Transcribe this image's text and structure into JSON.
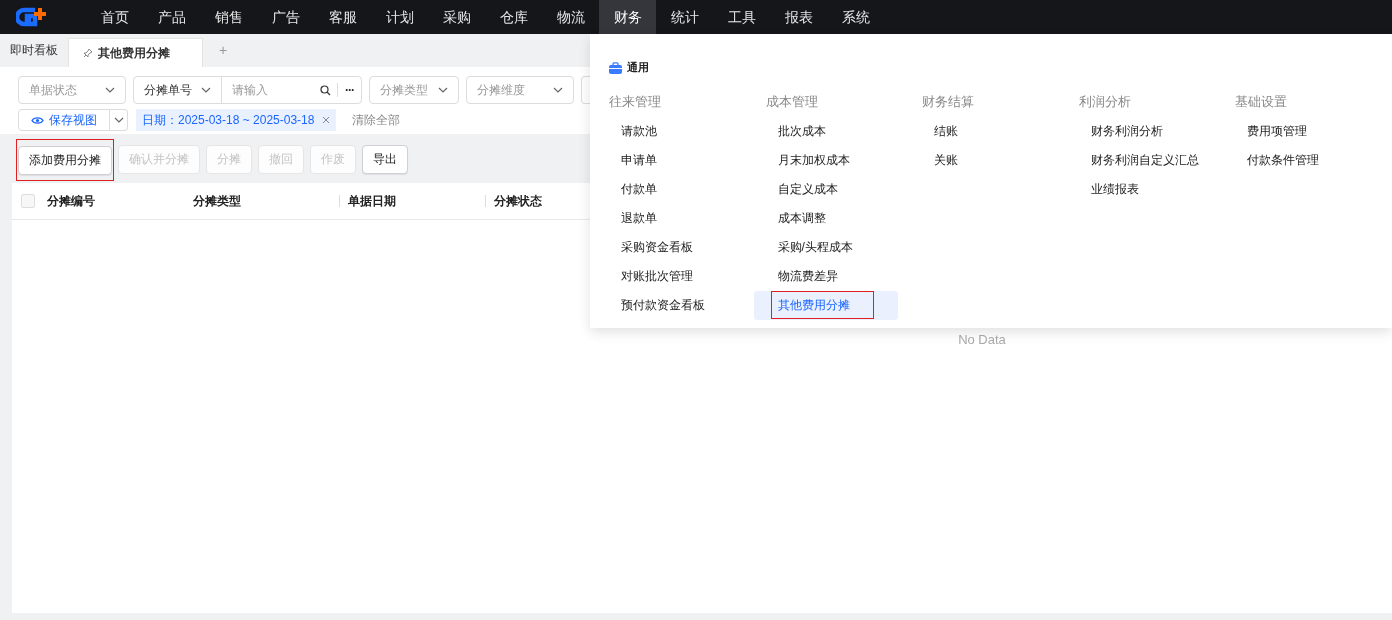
{
  "nav": {
    "items": [
      {
        "label": "首页",
        "selected": false
      },
      {
        "label": "产品",
        "selected": false
      },
      {
        "label": "销售",
        "selected": false
      },
      {
        "label": "广告",
        "selected": false
      },
      {
        "label": "客服",
        "selected": false
      },
      {
        "label": "计划",
        "selected": false
      },
      {
        "label": "采购",
        "selected": false
      },
      {
        "label": "仓库",
        "selected": false
      },
      {
        "label": "物流",
        "selected": false
      },
      {
        "label": "财务",
        "selected": true
      },
      {
        "label": "统计",
        "selected": false
      },
      {
        "label": "工具",
        "selected": false
      },
      {
        "label": "报表",
        "selected": false
      },
      {
        "label": "系统",
        "selected": false
      }
    ]
  },
  "tabs": [
    {
      "label": "即时看板",
      "selected": false,
      "pinned": false
    },
    {
      "label": "其他费用分摊",
      "selected": true,
      "pinned": true
    }
  ],
  "tab_add": "+",
  "filters": {
    "status": {
      "placeholder": "单据状态"
    },
    "search_type": "分摊单号",
    "search": {
      "placeholder": "请输入"
    },
    "more": "···",
    "type": {
      "placeholder": "分摊类型"
    },
    "dimension": {
      "placeholder": "分摊维度"
    }
  },
  "view_button": "保存视图",
  "active_filter": "日期：2025-03-18 ~ 2025-03-18",
  "clear_all": "清除全部",
  "toolbar": [
    {
      "label": "添加费用分摊",
      "disabled": false,
      "highlighted": true
    },
    {
      "label": "确认并分摊",
      "disabled": true,
      "highlighted": false
    },
    {
      "label": "分摊",
      "disabled": true,
      "highlighted": false
    },
    {
      "label": "撤回",
      "disabled": true,
      "highlighted": false
    },
    {
      "label": "作废",
      "disabled": true,
      "highlighted": false
    },
    {
      "label": "导出",
      "disabled": false,
      "highlighted": false
    }
  ],
  "table": {
    "select_all": {
      "checked": false
    },
    "columns": [
      "分摊编号",
      "分摊类型",
      "单据日期",
      "分摊状态"
    ],
    "empty": "No Data"
  },
  "menu": {
    "section": "通用",
    "groups": [
      {
        "title": "往来管理",
        "items": [
          {
            "label": "请款池",
            "selected": false,
            "highlighted": false
          },
          {
            "label": "申请单",
            "selected": false,
            "highlighted": false
          },
          {
            "label": "付款单",
            "selected": false,
            "highlighted": false
          },
          {
            "label": "退款单",
            "selected": false,
            "highlighted": false
          },
          {
            "label": "采购资金看板",
            "selected": false,
            "highlighted": false
          },
          {
            "label": "对账批次管理",
            "selected": false,
            "highlighted": false
          },
          {
            "label": "预付款资金看板",
            "selected": false,
            "highlighted": false
          }
        ]
      },
      {
        "title": "成本管理",
        "items": [
          {
            "label": "批次成本",
            "selected": false,
            "highlighted": false
          },
          {
            "label": "月末加权成本",
            "selected": false,
            "highlighted": false
          },
          {
            "label": "自定义成本",
            "selected": false,
            "highlighted": false
          },
          {
            "label": "成本调整",
            "selected": false,
            "highlighted": false
          },
          {
            "label": "采购/头程成本",
            "selected": false,
            "highlighted": false
          },
          {
            "label": "物流费差异",
            "selected": false,
            "highlighted": false
          },
          {
            "label": "其他费用分摊",
            "selected": true,
            "highlighted": true
          }
        ]
      },
      {
        "title": "财务结算",
        "items": [
          {
            "label": "结账",
            "selected": false,
            "highlighted": false
          },
          {
            "label": "关账",
            "selected": false,
            "highlighted": false
          }
        ]
      },
      {
        "title": "利润分析",
        "items": [
          {
            "label": "财务利润分析",
            "selected": false,
            "highlighted": false
          },
          {
            "label": "财务利润自定义汇总",
            "selected": false,
            "highlighted": false
          },
          {
            "label": "业绩报表",
            "selected": false,
            "highlighted": false
          }
        ]
      },
      {
        "title": "基础设置",
        "items": [
          {
            "label": "费用项管理",
            "selected": false,
            "highlighted": false
          },
          {
            "label": "付款条件管理",
            "selected": false,
            "highlighted": false
          }
        ]
      }
    ]
  }
}
